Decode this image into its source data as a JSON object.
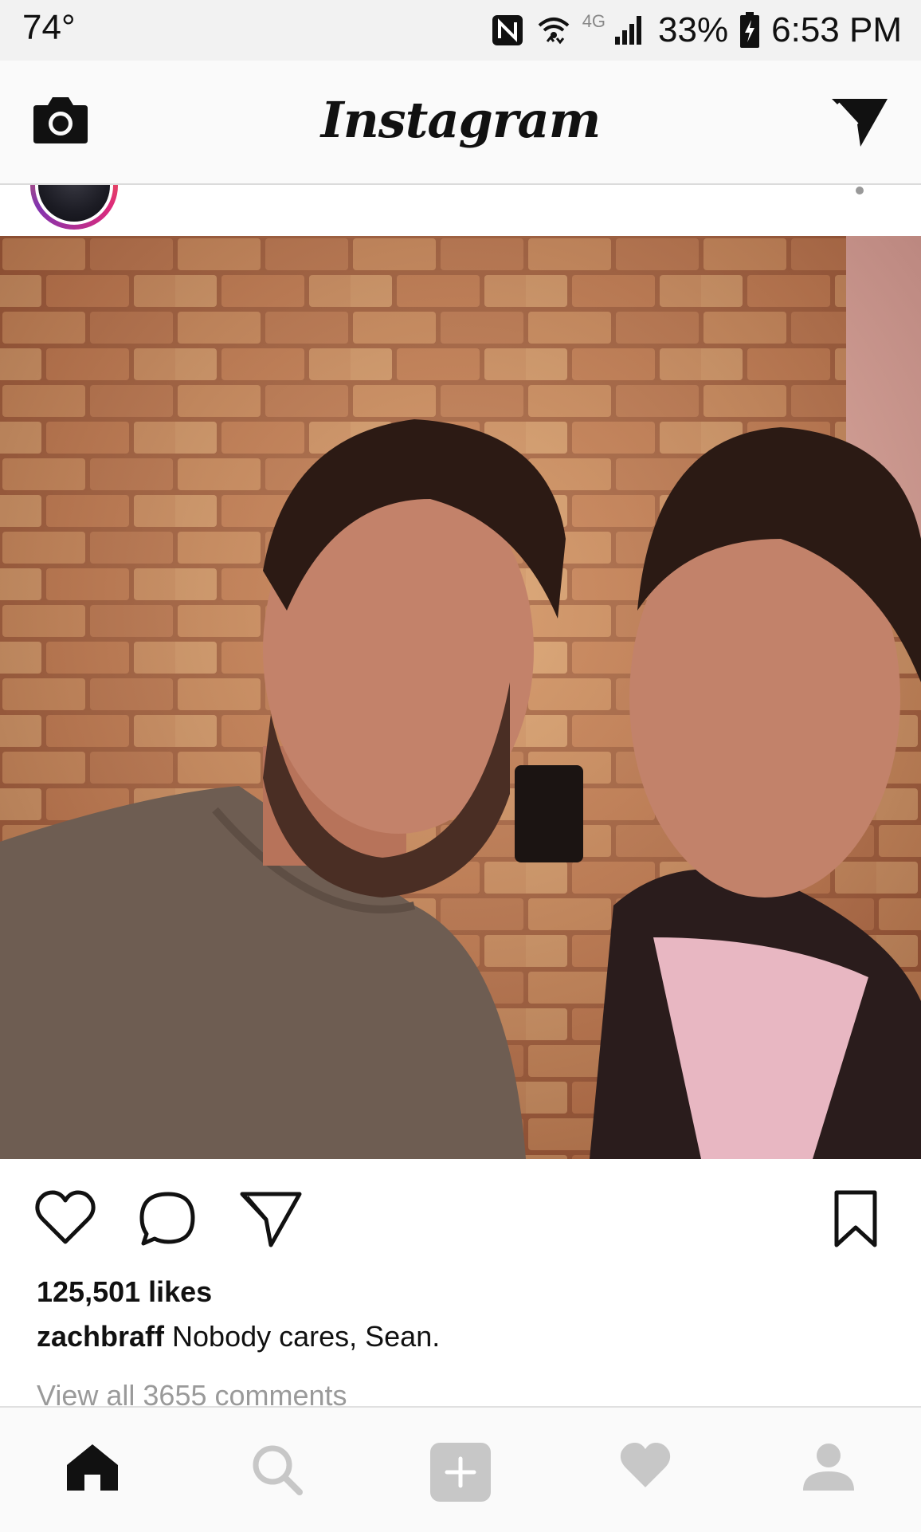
{
  "status_bar": {
    "temperature": "74°",
    "network_type": "4G",
    "battery": "33%",
    "time": "6:53 PM"
  },
  "app_header": {
    "logo_text": "Instagram",
    "camera_icon": "camera-icon",
    "direct_icon": "paper-plane-icon"
  },
  "post": {
    "likes": "125,501 likes",
    "caption_user": "zachbraff",
    "caption_text": "Nobody cares, Sean.",
    "view_comments": "View all 3655 comments"
  },
  "actions": [
    "heart-icon",
    "comment-icon",
    "share-icon",
    "bookmark-icon"
  ],
  "bottom_nav": [
    "home-icon",
    "search-icon",
    "add-icon",
    "activity-heart-icon",
    "profile-icon"
  ],
  "colors": {
    "header_bg": "#fafafa",
    "status_bg": "#f2f2f2",
    "muted_text": "#9a9a9a",
    "nav_inactive": "#c7c7c7"
  }
}
